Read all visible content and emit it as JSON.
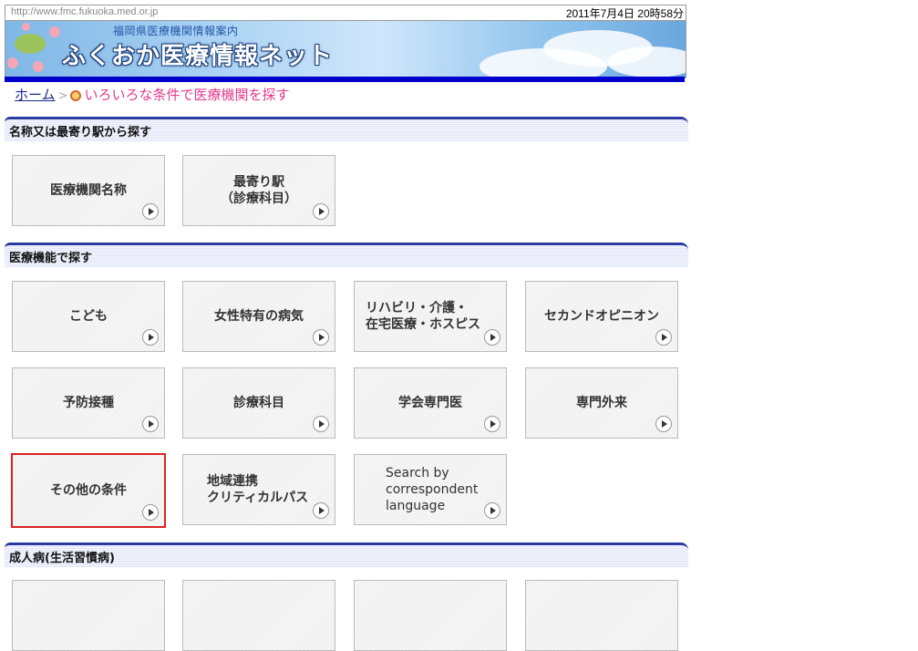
{
  "top": {
    "url": "http://www.fmc.fukuoka.med.or.jp",
    "datetime": "2011年7月4日 20時58分"
  },
  "banner": {
    "subtitle": "福岡県医療機関情報案内",
    "title": "ふくおか医療情報ネット"
  },
  "breadcrumb": {
    "home": "ホーム",
    "current": "いろいろな条件で医療機関を探す"
  },
  "sections": [
    {
      "title": "名称又は最寄り駅から探す",
      "buttons": [
        {
          "label": "医療機関名称"
        },
        {
          "label": "最寄り駅\n（診療科目）"
        }
      ]
    },
    {
      "title": "医療機能で探す",
      "buttons": [
        {
          "label": "こども"
        },
        {
          "label": "女性特有の病気"
        },
        {
          "label": "リハビリ・介護・\n在宅医療・ホスピス"
        },
        {
          "label": "セカンドオピニオン"
        },
        {
          "label": "予防接種"
        },
        {
          "label": "診療科目"
        },
        {
          "label": "学会専門医"
        },
        {
          "label": "専門外来"
        },
        {
          "label": "その他の条件"
        },
        {
          "label": "地域連携\nクリティカルパス"
        },
        {
          "label": "Search by\ncorrespondent\nlanguage"
        }
      ]
    },
    {
      "title": "成人病(生活習慣病)"
    }
  ],
  "colors": {
    "accent_blue": "#2a3aa0",
    "breadcrumb_current": "#e23a8c",
    "selected_border": "#dd2222"
  }
}
